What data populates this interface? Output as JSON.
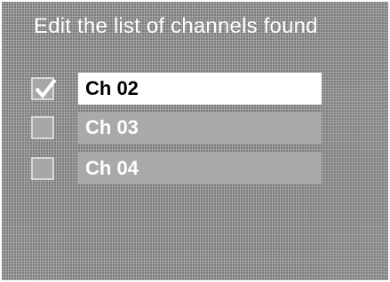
{
  "title": "Edit the list of channels found",
  "channels": [
    {
      "label": "Ch 02",
      "checked": true,
      "selected": true
    },
    {
      "label": "Ch 03",
      "checked": false,
      "selected": false
    },
    {
      "label": "Ch 04",
      "checked": false,
      "selected": false
    }
  ],
  "colors": {
    "background": "#8f8f8f",
    "selected_bg": "#ffffff",
    "unselected_bg": "#a9a9a9",
    "text_light": "#ffffff",
    "text_dark": "#000000"
  },
  "icons": {
    "checkmark": "checkmark-icon"
  }
}
